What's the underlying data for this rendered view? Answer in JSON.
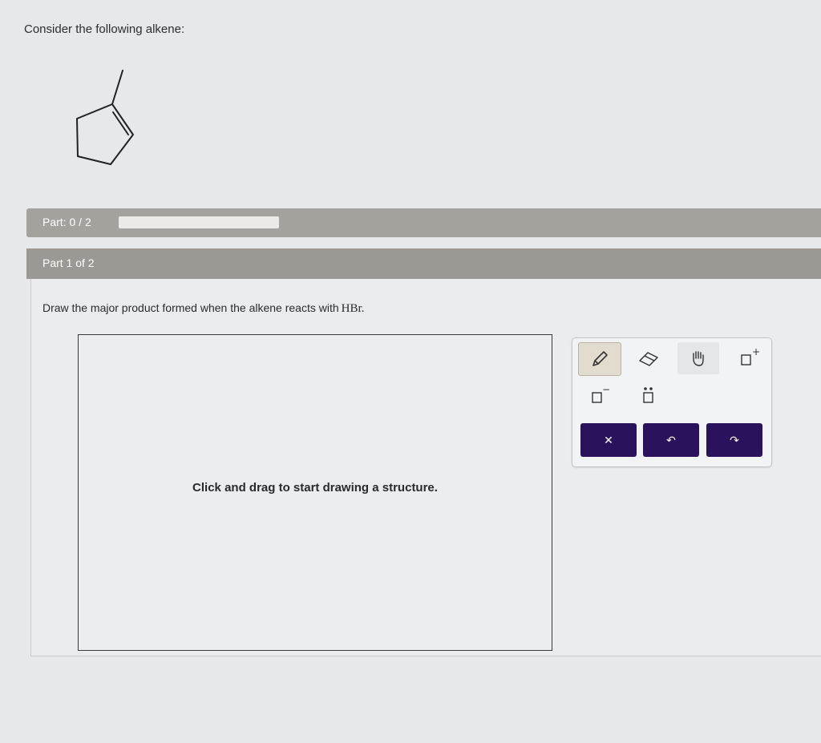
{
  "question": {
    "text": "Consider the following alkene:"
  },
  "part_progress": {
    "label": "Part:",
    "current": "0",
    "separator": "/",
    "total": "2",
    "progress_fraction": 0
  },
  "part_header": {
    "label": "Part 1 of 2"
  },
  "instruction": {
    "text": "Draw the major product formed when the alkene reacts with",
    "reagent": "HBr."
  },
  "canvas": {
    "hint": "Click and drag to start drawing a structure."
  },
  "toolbar": {
    "tools": [
      {
        "icon": "pencil-icon"
      },
      {
        "icon": "eraser-icon"
      },
      {
        "icon": "hand-icon"
      },
      {
        "icon": "add-charge-icon",
        "glyph": "+"
      },
      {
        "icon": "remove-charge-icon",
        "glyph": "−"
      },
      {
        "icon": "lone-pair-icon"
      }
    ],
    "actions": [
      {
        "icon": "clear-icon",
        "glyph": "✕"
      },
      {
        "icon": "undo-icon",
        "glyph": "↶"
      },
      {
        "icon": "redo-icon",
        "glyph": "↷"
      }
    ],
    "accent_color": "#2a135c"
  }
}
